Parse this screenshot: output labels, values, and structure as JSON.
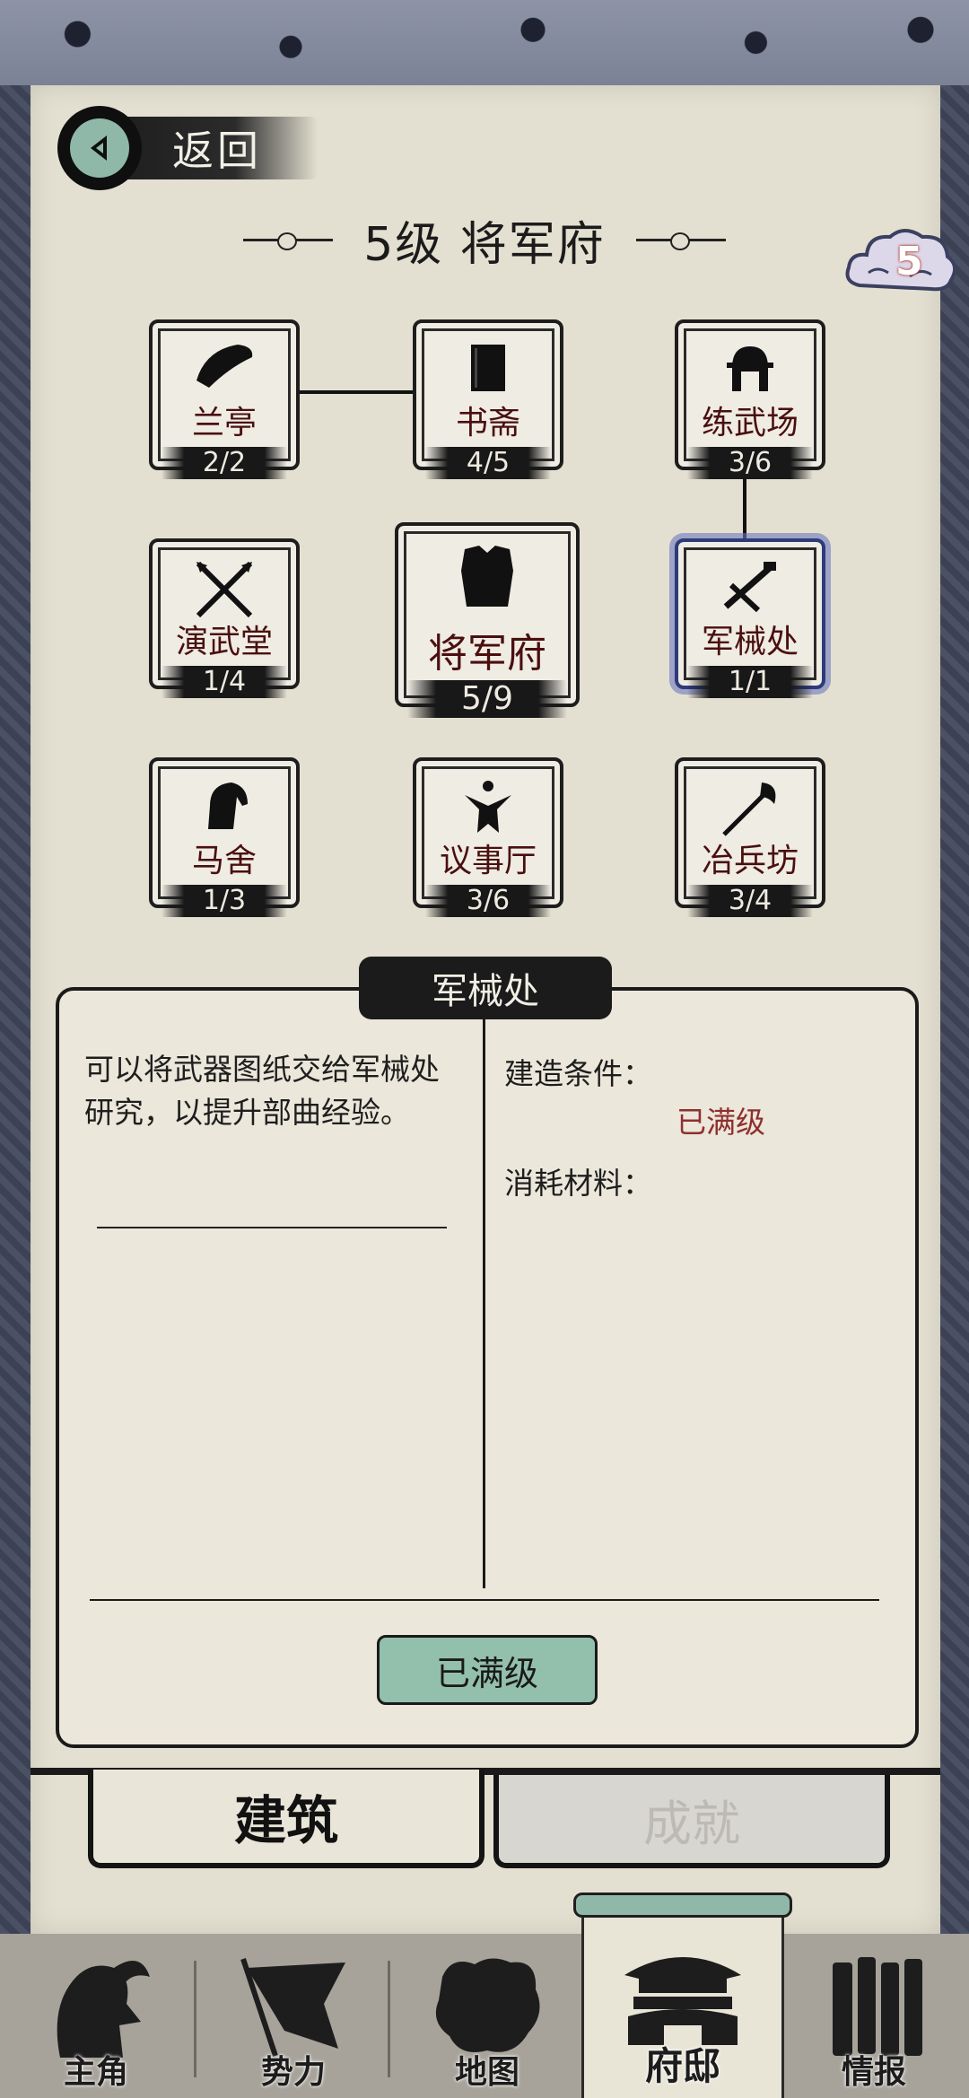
{
  "header": {
    "back_label": "返回",
    "title": "5级 将军府",
    "level_badge": "5"
  },
  "buildings": [
    {
      "id": "lanting",
      "name": "兰亭",
      "count": "2/2"
    },
    {
      "id": "shuzhai",
      "name": "书斋",
      "count": "4/5"
    },
    {
      "id": "lianwuchang",
      "name": "练武场",
      "count": "3/6"
    },
    {
      "id": "yanwutang",
      "name": "演武堂",
      "count": "1/4"
    },
    {
      "id": "jiangjunfu",
      "name": "将军府",
      "count": "5/9"
    },
    {
      "id": "junxiechu",
      "name": "军械处",
      "count": "1/1",
      "selected": true
    },
    {
      "id": "mashe",
      "name": "马舍",
      "count": "1/3"
    },
    {
      "id": "yishiting",
      "name": "议事厅",
      "count": "3/6"
    },
    {
      "id": "yebingfang",
      "name": "冶兵坊",
      "count": "3/4"
    }
  ],
  "detail": {
    "tab_title": "军械处",
    "description": "可以将武器图纸交给军械处研究，以提升部曲经验。",
    "build_condition_label": "建造条件：",
    "build_condition_value": "已满级",
    "materials_label": "消耗材料：",
    "action_button": "已满级"
  },
  "tabs": {
    "build": "建筑",
    "achievement": "成就"
  },
  "nav": [
    {
      "id": "hero",
      "label": "主角",
      "icon": "hero-portrait-icon"
    },
    {
      "id": "faction",
      "label": "势力",
      "icon": "flag-icon"
    },
    {
      "id": "map",
      "label": "地图",
      "icon": "map-icon"
    },
    {
      "id": "mansion",
      "label": "府邸",
      "icon": "mansion-icon",
      "active": true
    },
    {
      "id": "intel",
      "label": "情报",
      "icon": "scroll-icon"
    }
  ],
  "colors": {
    "paper": "#e4e0d1",
    "accent_green": "#93bfad",
    "building_name": "#4a0f0f",
    "maxed_red": "#8f2f2f",
    "selected_glow": "#2d3b7a"
  }
}
